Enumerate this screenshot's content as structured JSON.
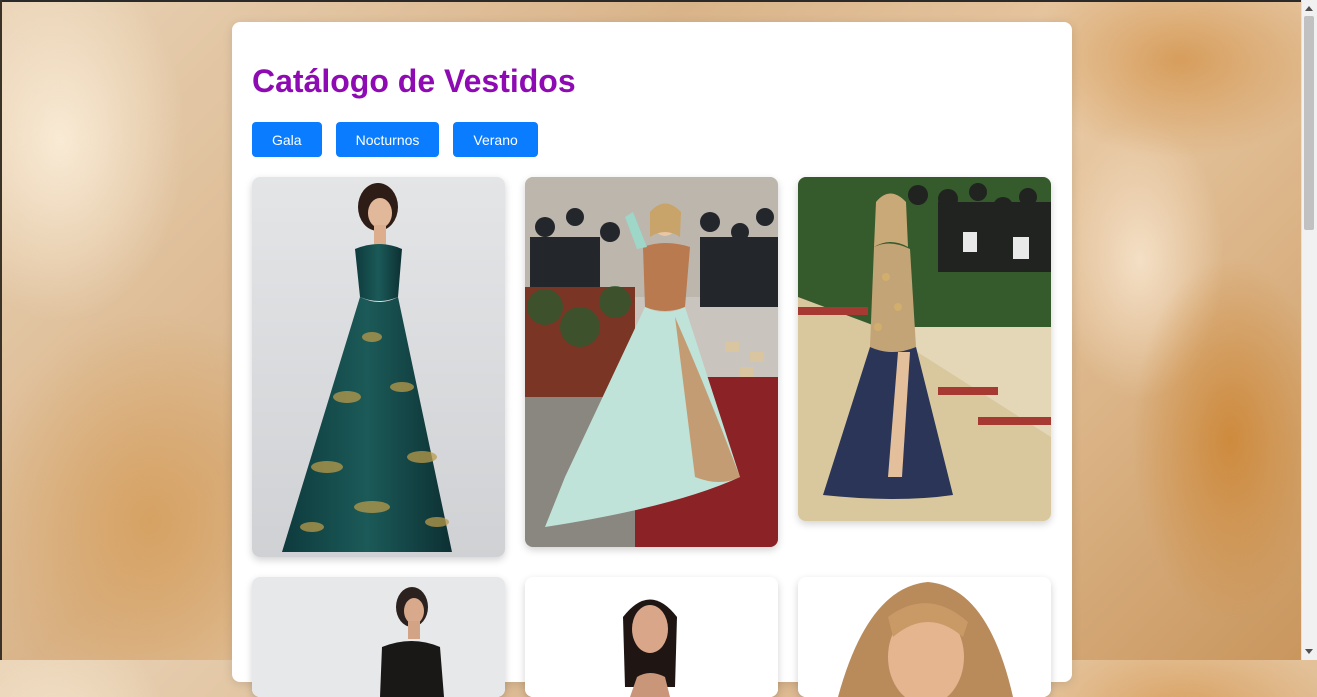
{
  "page": {
    "title": "Catálogo de Vestidos"
  },
  "filters": [
    "Gala",
    "Nocturnos",
    "Verano"
  ],
  "products": [
    {
      "image": "teal-brocade-strapless-gown"
    },
    {
      "image": "mint-copper-ballgown-red-carpet"
    },
    {
      "image": "gold-sequin-gown-with-slit"
    },
    {
      "image": "black-one-shoulder-dress"
    },
    {
      "image": "brunette-model-portrait"
    },
    {
      "image": "blonde-model-portrait"
    }
  ],
  "colors": {
    "title": "#8e0bb3",
    "button": "#0a7cff",
    "button_text": "#ffffff",
    "panel": "#ffffff"
  }
}
